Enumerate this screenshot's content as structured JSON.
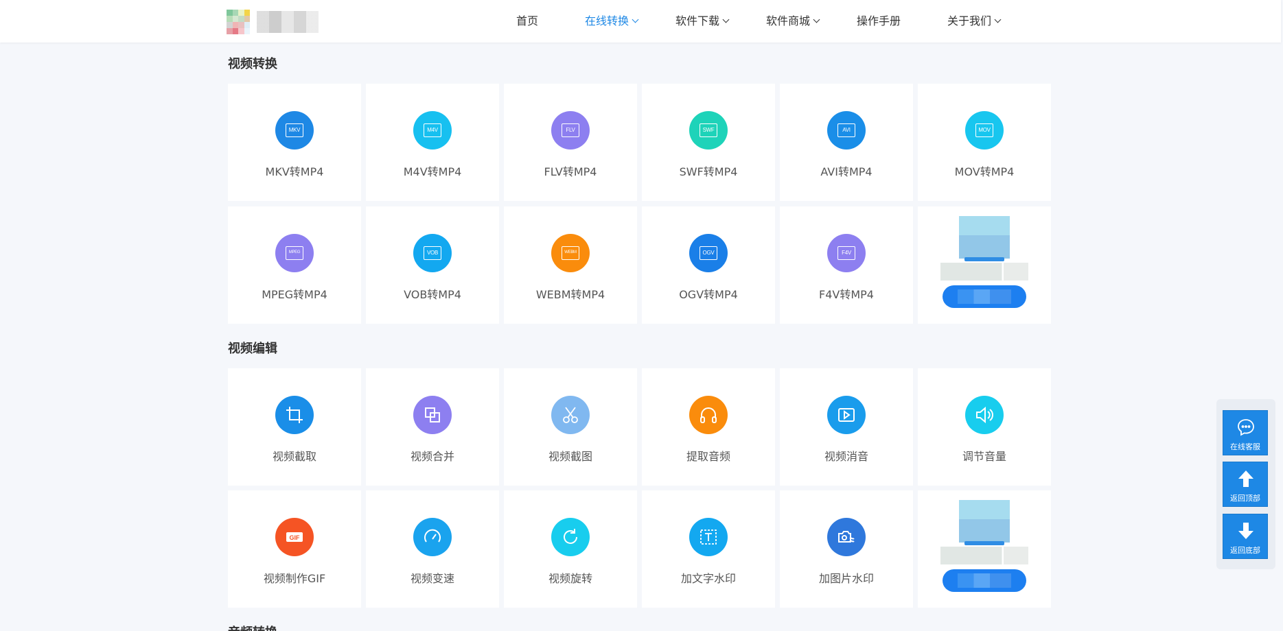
{
  "nav": {
    "items": [
      {
        "label": "首页",
        "active": false,
        "dropdown": false
      },
      {
        "label": "在线转换",
        "active": true,
        "dropdown": true
      },
      {
        "label": "软件下载",
        "active": false,
        "dropdown": true
      },
      {
        "label": "软件商城",
        "active": false,
        "dropdown": true
      },
      {
        "label": "操作手册",
        "active": false,
        "dropdown": false
      },
      {
        "label": "关于我们",
        "active": false,
        "dropdown": true
      }
    ]
  },
  "sections": {
    "video_convert": {
      "title": "视频转换",
      "cards": [
        {
          "label": "MKV转MP4",
          "icon": "mkv-icon",
          "badge": "MKV",
          "color": "#1e88e5"
        },
        {
          "label": "M4V转MP4",
          "icon": "m4v-icon",
          "badge": "M4V",
          "color": "#17c0f0"
        },
        {
          "label": "FLV转MP4",
          "icon": "flv-icon",
          "badge": "FLV",
          "color": "#8d7ff0"
        },
        {
          "label": "SWF转MP4",
          "icon": "swf-icon",
          "badge": "SWF",
          "color": "#1ed3b9"
        },
        {
          "label": "AVI转MP4",
          "icon": "avi-icon",
          "badge": "AVI",
          "color": "#1a8ee8"
        },
        {
          "label": "MOV转MP4",
          "icon": "mov-icon",
          "badge": "MOV",
          "color": "#18c6ef"
        },
        {
          "label": "MPEG转MP4",
          "icon": "mpeg-icon",
          "badge": "MPEG",
          "color": "#8d7ff0"
        },
        {
          "label": "VOB转MP4",
          "icon": "vob-icon",
          "badge": "VOB",
          "color": "#13a8f0"
        },
        {
          "label": "WEBM转MP4",
          "icon": "webm-icon",
          "badge": "WEBM",
          "color": "#fa8c0c"
        },
        {
          "label": "OGV转MP4",
          "icon": "ogv-icon",
          "badge": "OGV",
          "color": "#1a7fe8"
        },
        {
          "label": "F4V转MP4",
          "icon": "f4v-icon",
          "badge": "F4V",
          "color": "#8d7ff0"
        }
      ]
    },
    "video_edit": {
      "title": "视频编辑",
      "cards": [
        {
          "label": "视频截取",
          "icon": "crop-icon",
          "color": "#1a8ee8"
        },
        {
          "label": "视频合并",
          "icon": "merge-icon",
          "color": "#8d7ff0"
        },
        {
          "label": "视频截图",
          "icon": "scissors-icon",
          "color": "#80b8f0"
        },
        {
          "label": "提取音频",
          "icon": "headphones-icon",
          "color": "#fa8c0c"
        },
        {
          "label": "视频消音",
          "icon": "play-icon",
          "color": "#1a9cec"
        },
        {
          "label": "调节音量",
          "icon": "volume-icon",
          "color": "#18cdee"
        },
        {
          "label": "视频制作GIF",
          "icon": "gif-icon",
          "color": "#f55424"
        },
        {
          "label": "视频变速",
          "icon": "speedometer-icon",
          "color": "#1aa3ee"
        },
        {
          "label": "视频旋转",
          "icon": "rotate-icon",
          "color": "#18cdee"
        },
        {
          "label": "加文字水印",
          "icon": "text-watermark-icon",
          "color": "#13a8f0"
        },
        {
          "label": "加图片水印",
          "icon": "image-watermark-icon",
          "color": "#2f78dc"
        }
      ]
    },
    "audio_convert": {
      "title": "音频转换"
    }
  },
  "sidebar": {
    "service": "在线客服",
    "top": "返回顶部",
    "bottom": "返回底部"
  },
  "colors": {
    "accent": "#1e88e5",
    "page_bg": "#f5f7fb"
  }
}
